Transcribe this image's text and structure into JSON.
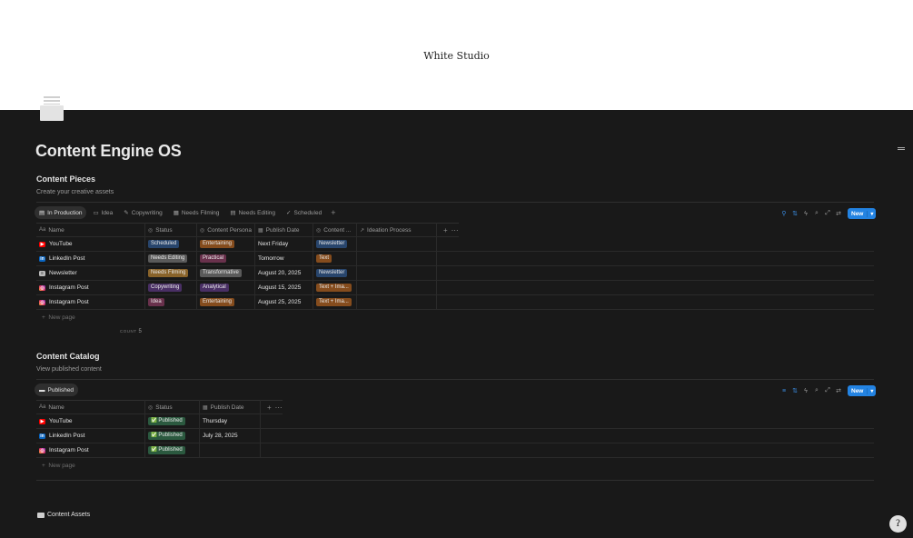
{
  "cover": {
    "title": "White Studio"
  },
  "page": {
    "title": "Content Engine OS"
  },
  "colors": {
    "accent": "#2383e2"
  },
  "content_pieces": {
    "title": "Content Pieces",
    "subtitle": "Create your creative assets",
    "tabs": [
      {
        "label": "In Production",
        "icon": "table-icon"
      },
      {
        "label": "Idea",
        "icon": "film-icon"
      },
      {
        "label": "Copywriting",
        "icon": "pencil-icon"
      },
      {
        "label": "Needs Filming",
        "icon": "gallery-icon"
      },
      {
        "label": "Needs Editing",
        "icon": "table-icon"
      },
      {
        "label": "Scheduled",
        "icon": "check-icon"
      }
    ],
    "new_label": "New",
    "columns": [
      "Name",
      "Status",
      "Content Persona",
      "Publish Date",
      "Content ...",
      "Ideation Process"
    ],
    "rows": [
      {
        "name": "YouTube",
        "icon": "youtube-icon",
        "status": "Scheduled",
        "persona": "Entertaining",
        "date": "Next Friday",
        "type": "Newsletter"
      },
      {
        "name": "LinkedIn Post",
        "icon": "linkedin-icon",
        "status": "Needs Editing",
        "persona": "Practical",
        "date": "Tomorrow",
        "type": "Text"
      },
      {
        "name": "Newsletter",
        "icon": "newsletter-icon",
        "status": "Needs Filming",
        "persona": "Transformative",
        "date": "August 20, 2025",
        "type": "Newsletter"
      },
      {
        "name": "Instagram Post",
        "icon": "instagram-icon",
        "status": "Copywriting",
        "persona": "Analytical",
        "date": "August 15, 2025",
        "type": "Text + Ima..."
      },
      {
        "name": "Instagram Post",
        "icon": "instagram-icon",
        "status": "Idea",
        "persona": "Entertaining",
        "date": "August 25, 2025",
        "type": "Text + Ima..."
      }
    ],
    "new_page": "New page",
    "count_label": "COUNT",
    "count_value": "5"
  },
  "content_catalog": {
    "title": "Content Catalog",
    "subtitle": "View published content",
    "tabs": [
      {
        "label": "Published",
        "icon": "book-icon"
      }
    ],
    "new_label": "New",
    "columns": [
      "Name",
      "Status",
      "Publish Date"
    ],
    "rows": [
      {
        "name": "YouTube",
        "icon": "youtube-icon",
        "status": "Published",
        "date": "Thursday"
      },
      {
        "name": "LinkedIn Post",
        "icon": "linkedin-icon",
        "status": "Published",
        "date": "July 28, 2025"
      },
      {
        "name": "Instagram Post",
        "icon": "instagram-icon",
        "status": "Published",
        "date": ""
      }
    ],
    "new_page": "New page"
  },
  "content_assets": {
    "title": "Content Assets"
  },
  "tag_colors": {
    "Scheduled": "#28456c",
    "Needs Editing": "#5a5a5a",
    "Needs Filming": "#89632a",
    "Copywriting": "#492f64",
    "Idea": "#69314c",
    "Entertaining": "#854c1d",
    "Practical": "#69314c",
    "Transformative": "#5a5a5a",
    "Analytical": "#492f64",
    "Newsletter": "#28456c",
    "Text": "#854c1d",
    "Text + Ima...": "#854c1d",
    "Published": "#2b593f"
  }
}
